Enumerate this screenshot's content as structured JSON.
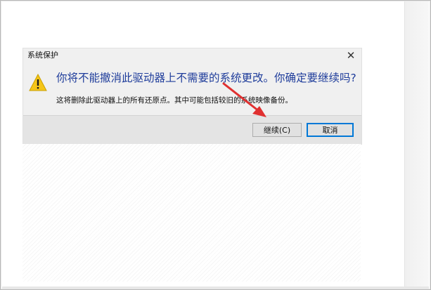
{
  "dialog": {
    "title": "系统保护",
    "close_glyph": "✕",
    "main_instruction": "你将不能撤消此驱动器上不需要的系统更改。你确定要继续吗?",
    "sub_text": "这将删除此驱动器上的所有还原点。其中可能包括较旧的系统映像备份。",
    "buttons": {
      "continue_label": "继续(C)",
      "cancel_label": "取消"
    },
    "icon": "warning-icon"
  },
  "annotation": {
    "color": "#e03030",
    "type": "arrow"
  },
  "colors": {
    "instruction_text": "#1f3d9b",
    "focus_border": "#0078d7",
    "warning_yellow": "#f5c518"
  }
}
